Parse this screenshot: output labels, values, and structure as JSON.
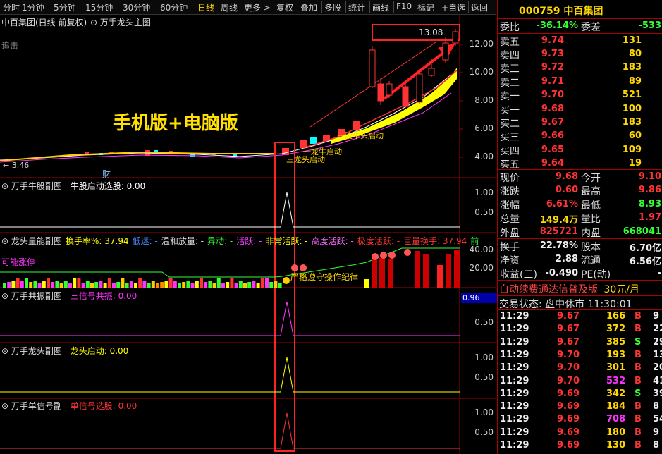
{
  "toolbar": {
    "periods": [
      "分时",
      "1分钟",
      "5分钟",
      "15分钟",
      "30分钟",
      "60分钟",
      "日线",
      "周线",
      "更多 >"
    ],
    "active": "日线",
    "tools": [
      "复权",
      "叠加",
      "多股",
      "统计",
      "画线",
      "F10",
      "标记",
      "+自选",
      "返回"
    ]
  },
  "main_chart": {
    "title": "中百集团(日线 前复权)",
    "indicator": "万手龙头主图",
    "left_tag": "追击",
    "promo": "手机版+电脑版",
    "price_labels": [
      "12.00",
      "10.00",
      "8.00",
      "6.00",
      "4.00"
    ],
    "high_label": "13.08",
    "low_label": "3.46",
    "cai_mark": "财",
    "ann_top": "一波牛头启动",
    "ann_mid": "一龙牛启动",
    "ann_low": "三龙头启动",
    "candles": [
      {
        "o": 9.0,
        "c": 11.6,
        "h": 11.9,
        "l": 8.9
      },
      {
        "o": 9.2,
        "c": 8.0,
        "h": 9.6,
        "l": 7.7
      },
      {
        "o": 8.4,
        "c": 9.2,
        "h": 9.4,
        "l": 8.2
      },
      {
        "o": 9.0,
        "c": 7.6,
        "h": 9.4,
        "l": 7.5
      },
      {
        "o": 7.9,
        "c": 9.9,
        "h": 10.1,
        "l": 7.8
      },
      {
        "o": 9.8,
        "c": 10.3,
        "h": 11.0,
        "l": 9.7
      },
      {
        "o": 10.9,
        "c": 12.1,
        "h": 12.5,
        "l": 10.7
      },
      {
        "o": 12.1,
        "c": 12.9,
        "h": 13.1,
        "l": 11.9
      }
    ]
  },
  "sub1": {
    "title": "万手牛股副图",
    "label": "牛股启动选股: 0.00",
    "axis": [
      "1.00",
      "0.50"
    ]
  },
  "sub2": {
    "title": "龙头量能副图",
    "items": [
      "换手率%: 37.94",
      "低迷: -",
      "温和放量: -",
      "异动: -",
      "活跃: -",
      "非常活跃: -",
      "高度活跃: -",
      "极度活跃: -",
      "巨量换手: 37.94",
      "前"
    ],
    "colors": [
      "#ffff00",
      "#4488ff",
      "#dddddd",
      "#33ff33",
      "#ff33ff",
      "#ffff00",
      "#ff66ff",
      "#ff3333",
      "#ff3333",
      "#33ff33"
    ],
    "tag": "可能涨停",
    "axis": [
      "40.00",
      "20.00"
    ],
    "note": "严格遵守操作纪律"
  },
  "sub3": {
    "title": "万手共振副图",
    "label": "三信号共振: 0.00",
    "axis": [
      "1.00",
      "0.50"
    ],
    "badge": "0.96"
  },
  "sub4": {
    "title": "万手龙头副图",
    "label": "龙头启动: 0.00",
    "axis": [
      "1.00",
      "0.50"
    ]
  },
  "sub5": {
    "title": "万手单信号副",
    "label": "单信号选股: 0.00",
    "axis": [
      "1.00",
      "0.50"
    ]
  },
  "quote": {
    "code": "000759",
    "name": "中百集团",
    "weibi_label": "委比",
    "weibi": "-36.14%",
    "weicha_label": "委差",
    "weicha": "-533",
    "asks": [
      {
        "label": "卖五",
        "price": "9.74",
        "vol": "131"
      },
      {
        "label": "卖四",
        "price": "9.73",
        "vol": "80"
      },
      {
        "label": "卖三",
        "price": "9.72",
        "vol": "183"
      },
      {
        "label": "卖二",
        "price": "9.71",
        "vol": "89"
      },
      {
        "label": "卖一",
        "price": "9.70",
        "vol": "521"
      }
    ],
    "bids": [
      {
        "label": "买一",
        "price": "9.68",
        "vol": "100"
      },
      {
        "label": "买二",
        "price": "9.67",
        "vol": "183"
      },
      {
        "label": "买三",
        "price": "9.66",
        "vol": "60"
      },
      {
        "label": "买四",
        "price": "9.65",
        "vol": "109"
      },
      {
        "label": "买五",
        "price": "9.64",
        "vol": "19"
      }
    ],
    "stats": [
      {
        "l1": "现价",
        "v1": "9.68",
        "c1": "red",
        "l2": "今开",
        "v2": "9.10",
        "c2": "red"
      },
      {
        "l1": "涨跌",
        "v1": "0.60",
        "c1": "red",
        "l2": "最高",
        "v2": "9.86",
        "c2": "red"
      },
      {
        "l1": "涨幅",
        "v1": "6.61%",
        "c1": "red",
        "l2": "最低",
        "v2": "8.93",
        "c2": "green"
      },
      {
        "l1": "总量",
        "v1": "149.4万",
        "c1": "yellow",
        "l2": "量比",
        "v2": "1.97",
        "c2": "red"
      },
      {
        "l1": "外盘",
        "v1": "825721",
        "c1": "red",
        "l2": "内盘",
        "v2": "668041",
        "c2": "green"
      }
    ],
    "stats2": [
      {
        "l1": "换手",
        "v1": "22.78%",
        "l2": "股本",
        "v2": "6.70亿"
      },
      {
        "l1": "净资",
        "v1": "2.88",
        "l2": "流通",
        "v2": "6.56亿"
      },
      {
        "l1": "收益(三)",
        "v1": "-0.490",
        "l2": "PE(动)",
        "v2": "-"
      }
    ],
    "ad_text": "自动续费通达信普及版",
    "ad_price": "30元/月",
    "status_label": "交易状态:",
    "status": "盘中休市",
    "status_time": "11:30:01",
    "ticks": [
      {
        "t": "11:29",
        "p": "9.67",
        "v": "166",
        "bs": "B",
        "n": "9",
        "vc": "yellow"
      },
      {
        "t": "11:29",
        "p": "9.67",
        "v": "372",
        "bs": "B",
        "n": "22",
        "vc": "yellow"
      },
      {
        "t": "11:29",
        "p": "9.67",
        "v": "385",
        "bs": "S",
        "n": "29",
        "vc": "yellow"
      },
      {
        "t": "11:29",
        "p": "9.70",
        "v": "193",
        "bs": "B",
        "n": "13",
        "vc": "yellow"
      },
      {
        "t": "11:29",
        "p": "9.70",
        "v": "301",
        "bs": "B",
        "n": "20",
        "vc": "yellow"
      },
      {
        "t": "11:29",
        "p": "9.70",
        "v": "532",
        "bs": "B",
        "n": "41",
        "vc": "mag"
      },
      {
        "t": "11:29",
        "p": "9.69",
        "v": "342",
        "bs": "S",
        "n": "39",
        "vc": "yellow"
      },
      {
        "t": "11:29",
        "p": "9.69",
        "v": "184",
        "bs": "B",
        "n": "8",
        "vc": "yellow"
      },
      {
        "t": "11:29",
        "p": "9.69",
        "v": "708",
        "bs": "B",
        "n": "54",
        "vc": "mag"
      },
      {
        "t": "11:29",
        "p": "9.69",
        "v": "180",
        "bs": "B",
        "n": "9",
        "vc": "yellow"
      },
      {
        "t": "11:29",
        "p": "9.69",
        "v": "130",
        "bs": "B",
        "n": "8",
        "vc": "yellow"
      }
    ]
  }
}
